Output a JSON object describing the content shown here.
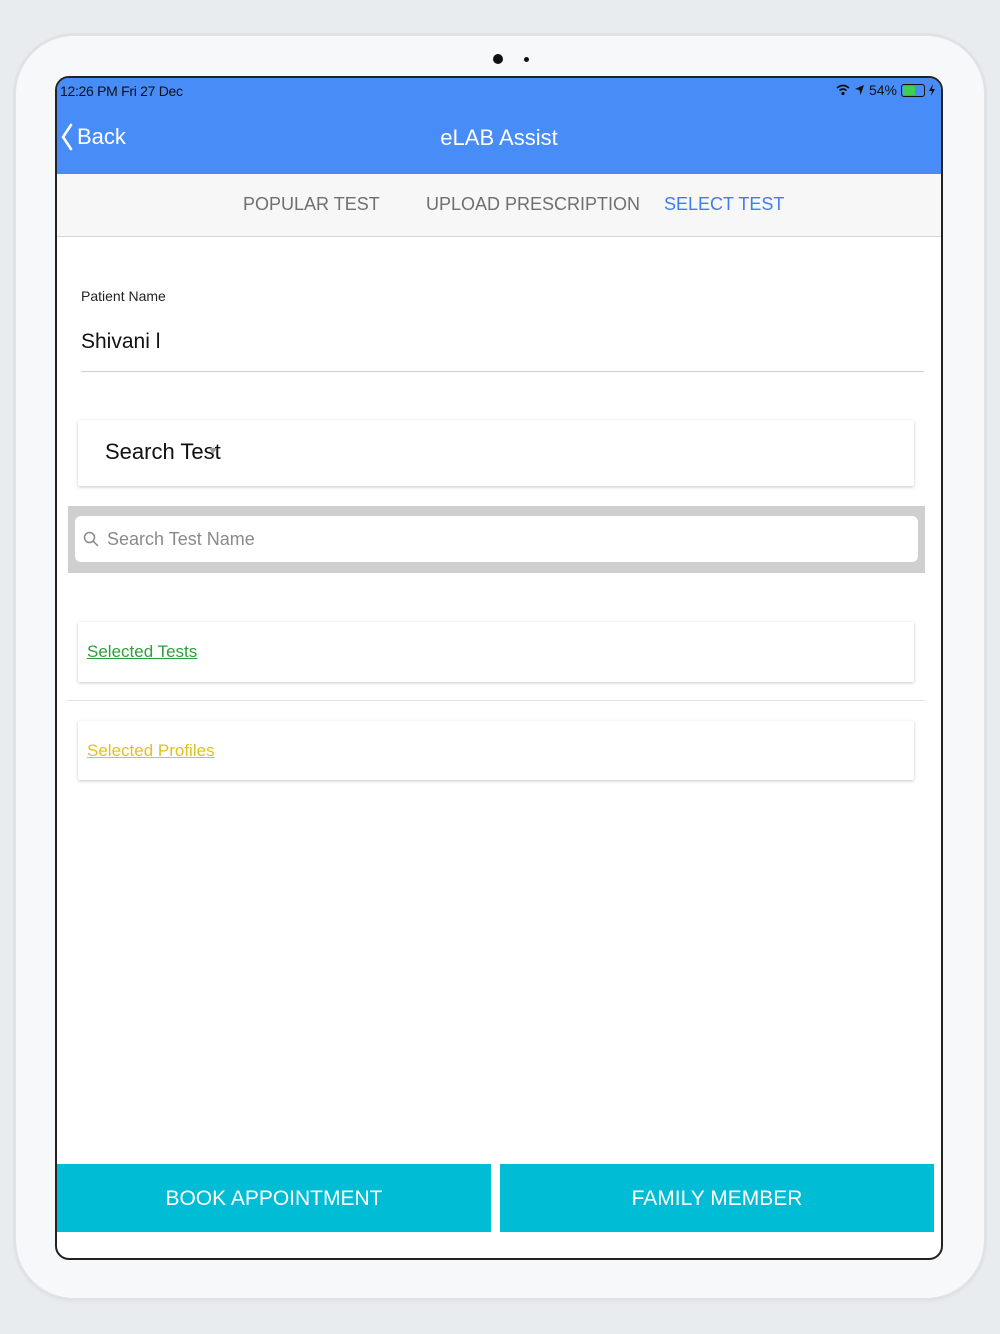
{
  "status": {
    "time_date": "12:26 PM   Fri 27 Dec",
    "battery": "54%",
    "battery_level": 0.54,
    "battery_color": "#3ecf4d"
  },
  "navbar": {
    "back_label": "Back",
    "title": "eLAB Assist",
    "color": "#478cf7"
  },
  "tabs": [
    {
      "label": "POPULAR TEST",
      "active": false
    },
    {
      "label": "UPLOAD PRESCRIPTION",
      "active": false
    },
    {
      "label": "SELECT TEST",
      "active": true
    }
  ],
  "patient": {
    "label": "Patient Name",
    "value": "Shivani l"
  },
  "search_test_dropdown": {
    "label": "Search Test"
  },
  "search": {
    "placeholder": "Search Test Name"
  },
  "sections": {
    "selected_tests": {
      "label": "Selected Tests",
      "color": "#2e9e3e"
    },
    "selected_profiles": {
      "label": "Selected Profiles",
      "color": "#e2c022"
    }
  },
  "footer": {
    "book_label": "BOOK APPOINTMENT",
    "family_label": "FAMILY MEMBER",
    "color": "#00bcd4"
  }
}
